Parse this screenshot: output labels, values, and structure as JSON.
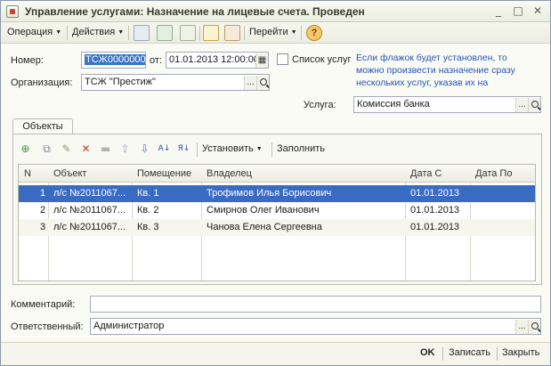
{
  "window": {
    "title": "Управление услугами: Назначение на лицевые счета. Проведен",
    "controls": [
      "minimize",
      "maximize",
      "close"
    ]
  },
  "toolbar": {
    "operation": "Операция",
    "actions": "Действия",
    "goto": "Перейти",
    "help": "?"
  },
  "header": {
    "number_label": "Номер:",
    "number_value": "ТСЖ00000000",
    "date_label": "от:",
    "date_value": "01.01.2013 12:00:00",
    "list_label": "Список услуг",
    "org_label": "Организация:",
    "org_value": "ТСЖ \"Престиж\"",
    "hint": "Если флажок будет установлен, то можно произвести назначение сразу нескольких услуг, указав их на",
    "service_label": "Услуга:",
    "service_value": "Комиссия банка"
  },
  "tabs": [
    {
      "label": "Объекты"
    }
  ],
  "grid_toolbar": {
    "set": "Установить",
    "fill": "Заполнить"
  },
  "table": {
    "headers": [
      "N",
      "Объект",
      "Помещение",
      "Владелец",
      "Дата С",
      "Дата По"
    ],
    "rows": [
      {
        "n": "1",
        "object": "л/с №2011067...",
        "room": "Кв. 1",
        "owner": "Трофимов Илья Борисович",
        "date_from": "01.01.2013",
        "date_to": ""
      },
      {
        "n": "2",
        "object": "л/с №2011067...",
        "room": "Кв. 2",
        "owner": "Смирнов Олег Иванович",
        "date_from": "01.01.2013",
        "date_to": ""
      },
      {
        "n": "3",
        "object": "л/с №2011067...",
        "room": "Кв. 3",
        "owner": "Чанова Елена Сергеевна",
        "date_from": "01.01.2013",
        "date_to": ""
      }
    ]
  },
  "footer": {
    "comment_label": "Комментарий:",
    "comment_value": "",
    "responsible_label": "Ответственный:",
    "responsible_value": "Администратор",
    "ok": "OK",
    "save": "Записать",
    "close": "Закрыть"
  },
  "colors": {
    "selection": "#3a6bc3",
    "hint_text": "#2456b3"
  }
}
